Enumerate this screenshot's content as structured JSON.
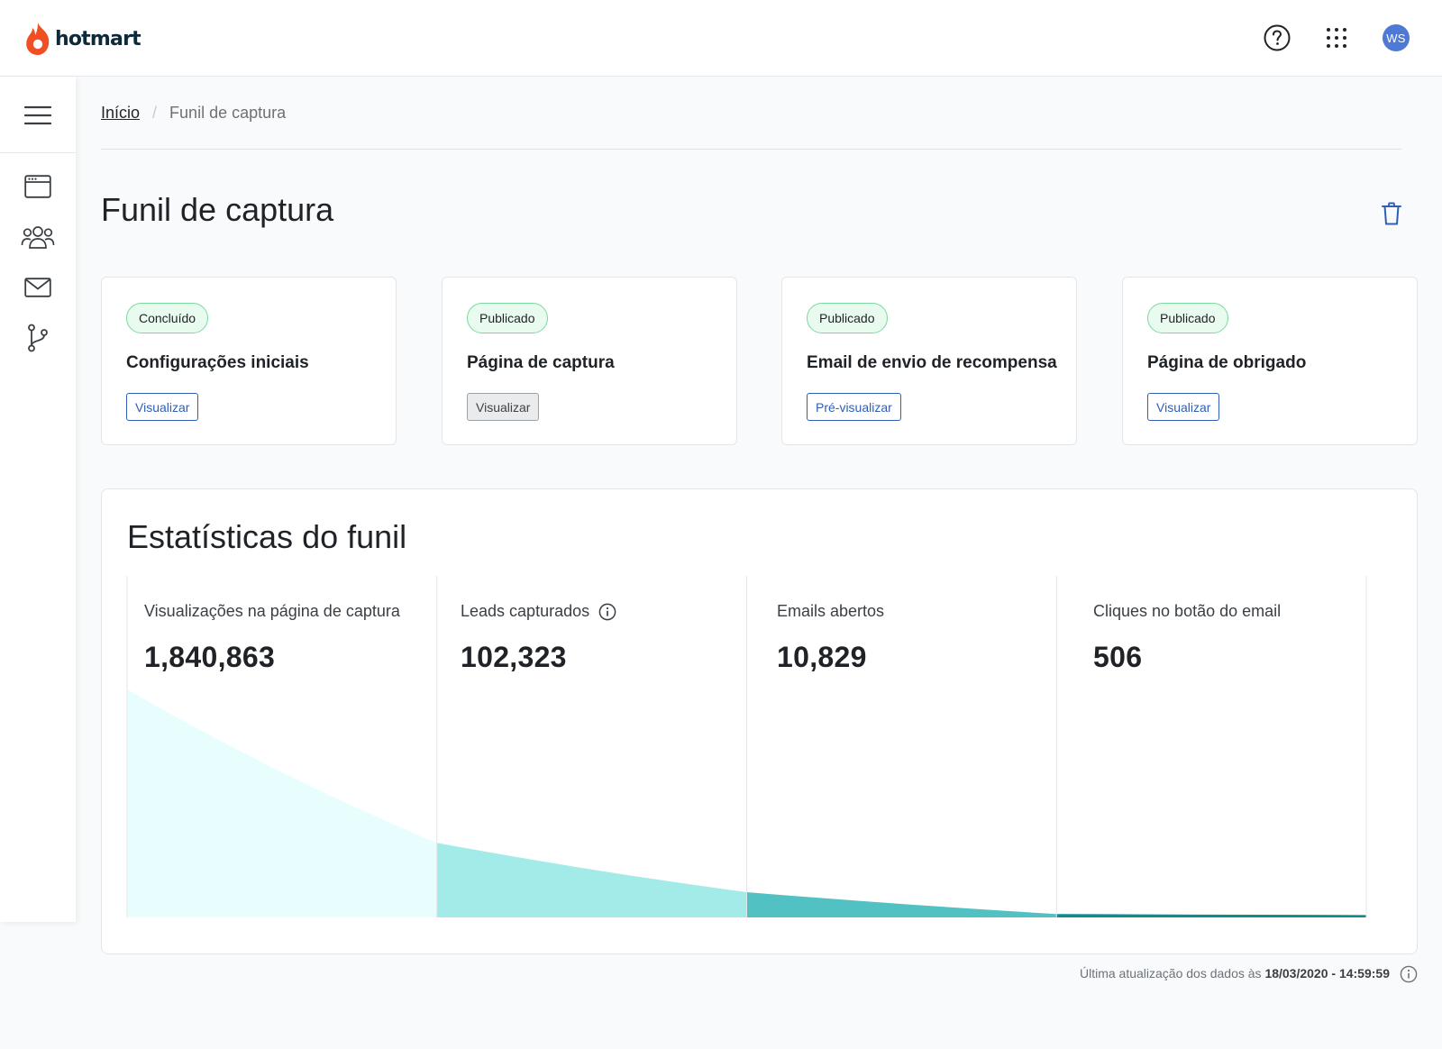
{
  "header": {
    "logo_text": "hotmart",
    "avatar_initials": "WS"
  },
  "breadcrumb": {
    "home": "Início",
    "separator": "/",
    "current": "Funil de captura"
  },
  "page": {
    "title": "Funil de captura"
  },
  "steps": [
    {
      "status": "Concluído",
      "title": "Configurações iniciais",
      "button": "Visualizar",
      "button_style": "outline"
    },
    {
      "status": "Publicado",
      "title": "Página de captura",
      "button": "Visualizar",
      "button_style": "gray"
    },
    {
      "status": "Publicado",
      "title": "Email de envio de recompensa",
      "button": "Pré-visualizar",
      "button_style": "outline"
    },
    {
      "status": "Publicado",
      "title": "Página de obrigado",
      "button": "Visualizar",
      "button_style": "outline"
    }
  ],
  "stats": {
    "title": "Estatísticas do funil",
    "metrics": [
      {
        "label": "Visualizações na página de captura",
        "value": "1,840,863",
        "info": false
      },
      {
        "label": "Leads capturados",
        "value": "102,323",
        "info": true
      },
      {
        "label": "Emails abertos",
        "value": "10,829",
        "info": false
      },
      {
        "label": "Cliques no botão do email",
        "value": "506",
        "info": false
      }
    ]
  },
  "chart_data": {
    "type": "area",
    "categories": [
      "Visualizações na página de captura",
      "Leads capturados",
      "Emails abertos",
      "Cliques no botão do email"
    ],
    "values": [
      1840863,
      102323,
      10829,
      506
    ],
    "segment_colors": [
      "#e8fdfd",
      "#a3ebe9",
      "#52c1c3",
      "#0b8e8c"
    ]
  },
  "footer": {
    "prefix": "Última atualização dos dados às ",
    "timestamp": "18/03/2020 - 14:59:59"
  },
  "colors": {
    "brand_flame": "#f04e23",
    "link_blue": "#2f5fb3",
    "badge_green_border": "#7bd8a0",
    "avatar_blue": "#4e79d4"
  }
}
